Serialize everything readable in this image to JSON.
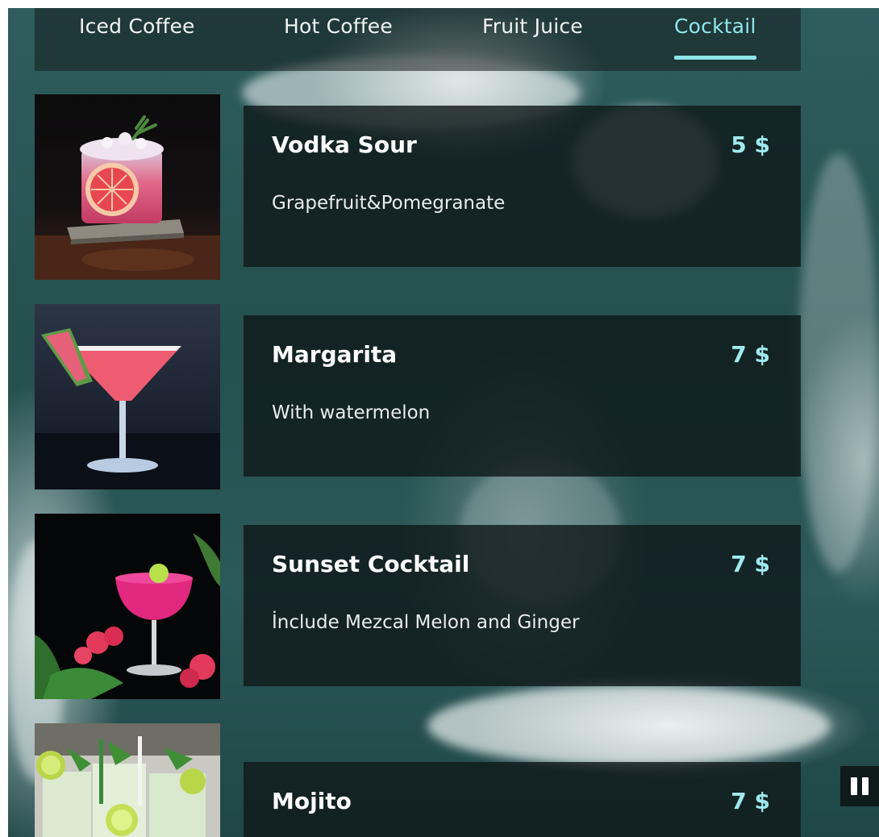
{
  "tabs": [
    {
      "label": "Iced Coffee",
      "active": false
    },
    {
      "label": "Hot Coffee",
      "active": false
    },
    {
      "label": "Fruit Juice",
      "active": false
    },
    {
      "label": "Cocktail",
      "active": true
    }
  ],
  "colors": {
    "accent": "#8fe6ea",
    "price": "#9fe9ee",
    "card_background": "#101a1b",
    "ocean": "#2b5859"
  },
  "products": [
    {
      "name": "Vodka Sour",
      "price": "5 $",
      "description": "Grapefruit&Pomegranate",
      "image_icon": "grapefruit-cocktail-photo"
    },
    {
      "name": "Margarita",
      "price": "7 $",
      "description": "With watermelon",
      "image_icon": "margarita-glass-photo"
    },
    {
      "name": "Sunset Cocktail",
      "price": "7 $",
      "description": "İnclude Mezcal Melon and Ginger",
      "image_icon": "pink-coupe-cocktail-photo"
    },
    {
      "name": "Mojito",
      "price": "7 $",
      "description": "",
      "image_icon": "mojito-glasses-photo"
    }
  ],
  "controls": {
    "pause_icon": "pause-icon"
  }
}
